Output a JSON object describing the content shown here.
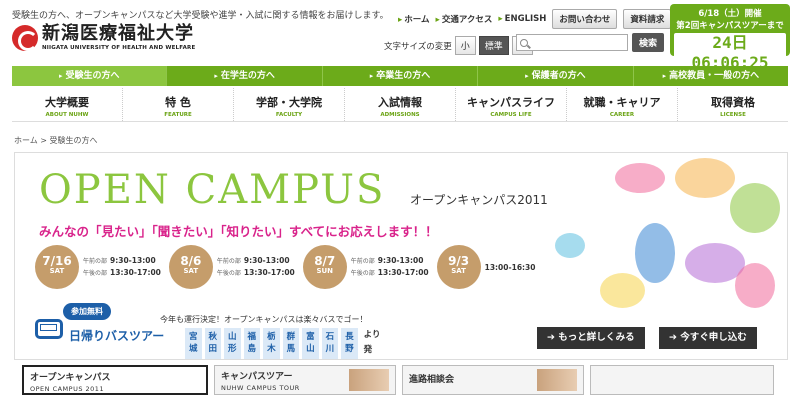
{
  "header": {
    "tagline": "受験生の方へ、オープンキャンパスなど大学受験や進学・入試に関する情報をお届けします。",
    "logo_jp": "新潟医療福祉大学",
    "logo_en": "NIIGATA UNIVERSITY OF HEALTH AND WELFARE",
    "top_links": [
      "ホーム",
      "交通アクセス",
      "ENGLISH"
    ],
    "contact_label": "お問い合わせ",
    "materials_label": "資料請求",
    "font_size_label": "文字サイズの変更",
    "font_sizes": [
      "小",
      "標準",
      "大"
    ],
    "search_placeholder": "",
    "search_button": "検索"
  },
  "countdown": {
    "line1": "6/18（土）開催",
    "line2": "第2回キャンパスツアーまで",
    "timer": "24日06:06:25"
  },
  "green_nav": [
    "受験生の方へ",
    "在学生の方へ",
    "卒業生の方へ",
    "保護者の方へ",
    "高校教員・一般の方へ"
  ],
  "main_nav": [
    {
      "jp": "大学概要",
      "en": "ABOUT NUHW"
    },
    {
      "jp": "特 色",
      "en": "FEATURE"
    },
    {
      "jp": "学部・大学院",
      "en": "FACULTY"
    },
    {
      "jp": "入試情報",
      "en": "ADMISSIONS"
    },
    {
      "jp": "キャンパスライフ",
      "en": "CAMPUS LIFE"
    },
    {
      "jp": "就職・キャリア",
      "en": "CAREER"
    },
    {
      "jp": "取得資格",
      "en": "LICENSE"
    }
  ],
  "breadcrumb": "ホーム > 受験生の方へ",
  "hero": {
    "title": "OPEN CAMPUS",
    "subtitle": "オープンキャンパス2011",
    "tagline": "みんなの「見たい」「聞きたい」「知りたい」すべてにお応えします！！",
    "dates": [
      {
        "date": "7/16",
        "day": "SAT",
        "am_label": "午前の部",
        "am": "9:30-13:00",
        "pm_label": "午後の部",
        "pm": "13:30-17:00"
      },
      {
        "date": "8/6",
        "day": "SAT",
        "am_label": "午前の部",
        "am": "9:30-13:00",
        "pm_label": "午後の部",
        "pm": "13:30-17:00"
      },
      {
        "date": "8/7",
        "day": "SUN",
        "am_label": "午前の部",
        "am": "9:30-13:00",
        "pm_label": "午後の部",
        "pm": "13:30-17:00"
      },
      {
        "date": "9/3",
        "day": "SAT",
        "single": "13:00-16:30"
      }
    ],
    "bus_badge": "参加無料",
    "bus_title": "日帰りバスツアー",
    "bus_note": "今年も運行決定！オープンキャンパスは楽々バスでゴー！",
    "cities": [
      "宮城",
      "秋田",
      "山形",
      "福島",
      "栃木",
      "群馬",
      "富山",
      "石川",
      "長野"
    ],
    "cities_after": "より発着！",
    "more_button": "もっと詳しくみる",
    "apply_button": "今すぐ申し込む"
  },
  "bottom_tabs": [
    {
      "jp": "オープンキャンパス",
      "en": "OPEN CAMPUS 2011"
    },
    {
      "jp": "キャンパスツアー",
      "en": "NUHW CAMPUS TOUR"
    },
    {
      "jp": "進路相談会",
      "en": ""
    }
  ],
  "colors": {
    "brand_green": "#6cab1a",
    "hero_green": "#8cc63f",
    "accent_pink": "#d9238b",
    "date_brown": "#c59d6b",
    "bus_blue": "#1d5fa8"
  }
}
